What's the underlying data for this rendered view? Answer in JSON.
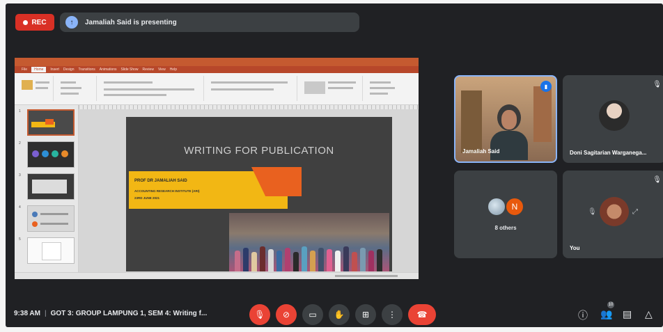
{
  "top_bar": {
    "rec_label": "REC",
    "presenting_text": "Jamaliah Said is presenting"
  },
  "slide": {
    "title": "WRITING FOR PUBLICATION",
    "name": "PROF DR JAMALIAH SAID",
    "institute": "ACCOUNTING RESEARCH INSTITUTE (ARI)",
    "date": "23RD JUNE 2021"
  },
  "ppt": {
    "tabs": [
      "File",
      "Home",
      "Insert",
      "Design",
      "Transitions",
      "Animations",
      "Slide Show",
      "Review",
      "View",
      "Help"
    ],
    "thumbnail_numbers": [
      "1",
      "2",
      "3",
      "4",
      "5"
    ]
  },
  "participants": [
    {
      "name": "Jamaliah Said",
      "speaking": true
    },
    {
      "name": "Doni Sagitarian Warganega..."
    },
    {
      "name": "8 others",
      "avatar_letter": "N"
    },
    {
      "name": "You"
    }
  ],
  "bottom_bar": {
    "time": "9:38 AM",
    "meeting_title": "GOT 3: GROUP LAMPUNG 1, SEM 4: Writing f...",
    "people_count": "10"
  },
  "colors": {
    "background": "#202124",
    "tile": "#3c4043",
    "red": "#ea4335",
    "slide_yellow": "#f2b714",
    "slide_orange": "#e9611f",
    "ppt_brand": "#b7472a"
  },
  "icons": [
    "mic-off-icon",
    "camera-off-icon",
    "captions-icon",
    "raise-hand-icon",
    "present-icon",
    "more-options-icon",
    "end-call-icon",
    "info-icon",
    "people-icon",
    "chat-icon",
    "activities-icon"
  ]
}
